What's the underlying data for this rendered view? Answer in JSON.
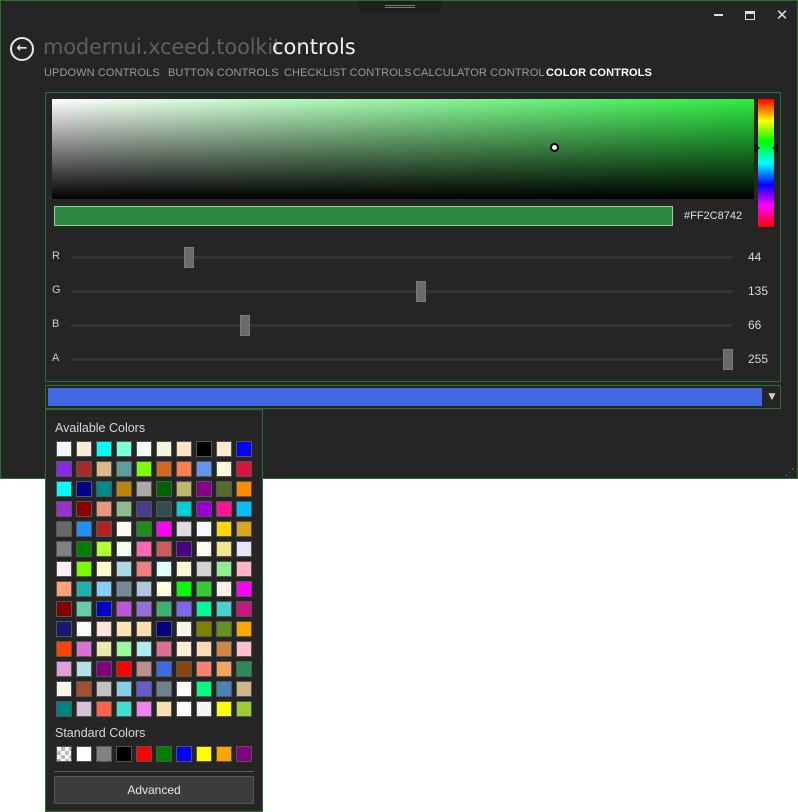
{
  "window": {
    "app_title": "modernui.xceed.toolkit",
    "page_title": "controls",
    "controls": {
      "minimize": "",
      "maximize": "",
      "close": "✕"
    }
  },
  "tabs": [
    {
      "label": "UPDOWN CONTROLS",
      "active": false
    },
    {
      "label": "BUTTON CONTROLS",
      "active": false
    },
    {
      "label": "CHECKLIST CONTROLS",
      "active": false
    },
    {
      "label": "CALCULATOR CONTROL",
      "active": false
    },
    {
      "label": "COLOR CONTROLS",
      "active": true
    }
  ],
  "color_canvas": {
    "hex": "#FF2C8742",
    "hue_color": "#2dec43",
    "preview_color": "#2c8742",
    "sliders": [
      {
        "label": "R",
        "value": "44",
        "max": 255
      },
      {
        "label": "G",
        "value": "135",
        "max": 255
      },
      {
        "label": "B",
        "value": "66",
        "max": 255
      },
      {
        "label": "A",
        "value": "255",
        "max": 255
      }
    ]
  },
  "color_picker": {
    "selected_color": "#4169e1",
    "available_title": "Available Colors",
    "standard_title": "Standard Colors",
    "advanced_label": "Advanced",
    "available_colors": [
      "#f0f8ff",
      "#faebd7",
      "#00ffff",
      "#7fffd4",
      "#f0ffff",
      "#f5f5dc",
      "#ffe4c4",
      "#000000",
      "#ffebcd",
      "#0000ff",
      "#8a2be2",
      "#a52a2a",
      "#deb887",
      "#5f9ea0",
      "#7fff00",
      "#d2691e",
      "#ff7f50",
      "#6495ed",
      "#fff8dc",
      "#dc143c",
      "#00ffff",
      "#00008b",
      "#008b8b",
      "#b8860b",
      "#a9a9a9",
      "#006400",
      "#bdb76b",
      "#8b008b",
      "#556b2f",
      "#ff8c00",
      "#9932cc",
      "#8b0000",
      "#e9967a",
      "#8fbc8f",
      "#483d8b",
      "#2f4f4f",
      "#00ced1",
      "#9400d3",
      "#ff1493",
      "#00bfff",
      "#696969",
      "#1e90ff",
      "#b22222",
      "#fffaf0",
      "#228b22",
      "#ff00ff",
      "#dcdcdc",
      "#f8f8ff",
      "#ffd700",
      "#daa520",
      "#808080",
      "#008000",
      "#adff2f",
      "#f0fff0",
      "#ff69b4",
      "#cd5c5c",
      "#4b0082",
      "#fffff0",
      "#f0e68c",
      "#e6e6fa",
      "#fff0f5",
      "#7cfc00",
      "#fffacd",
      "#add8e6",
      "#f08080",
      "#e0ffff",
      "#fafad2",
      "#d3d3d3",
      "#90ee90",
      "#ffb6c1",
      "#ffa07a",
      "#20b2aa",
      "#87cefa",
      "#778899",
      "#b0c4de",
      "#ffffe0",
      "#00ff00",
      "#32cd32",
      "#faf0e6",
      "#ff00ff",
      "#800000",
      "#66cdaa",
      "#0000cd",
      "#ba55d3",
      "#9370db",
      "#3cb371",
      "#7b68ee",
      "#00fa9a",
      "#48d1cc",
      "#c71585",
      "#191970",
      "#f5fffa",
      "#ffe4e1",
      "#ffe4b5",
      "#ffdead",
      "#000080",
      "#fdf5e6",
      "#808000",
      "#6b8e23",
      "#ffa500",
      "#ff4500",
      "#da70d6",
      "#eee8aa",
      "#98fb98",
      "#afeeee",
      "#db7093",
      "#ffefd5",
      "#ffdab9",
      "#cd853f",
      "#ffc0cb",
      "#dda0dd",
      "#b0e0e6",
      "#800080",
      "#ff0000",
      "#bc8f8f",
      "#4169e1",
      "#8b4513",
      "#fa8072",
      "#f4a460",
      "#2e8b57",
      "#fff5ee",
      "#a0522d",
      "#c0c0c0",
      "#87ceeb",
      "#6a5acd",
      "#708090",
      "#fffafa",
      "#00ff7f",
      "#4682b4",
      "#d2b48c",
      "#008080",
      "#d8bfd8",
      "#ff6347",
      "#40e0d0",
      "#ee82ee",
      "#f5deb3",
      "#ffffff",
      "#f5f5f5",
      "#ffff00",
      "#9acd32"
    ],
    "standard_colors": [
      "transparent",
      "#ffffff",
      "#808080",
      "#000000",
      "#ff0000",
      "#008000",
      "#0000ff",
      "#ffff00",
      "#ffa500",
      "#800080"
    ]
  }
}
